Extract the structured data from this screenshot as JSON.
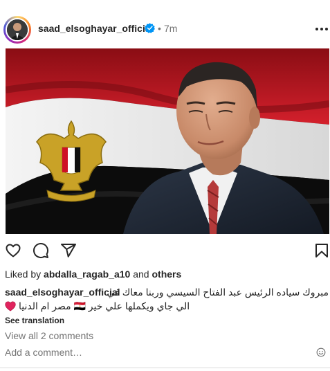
{
  "post": {
    "username": "saad_elsoghayar_official",
    "dot": "•",
    "timestamp": "7m",
    "liked_prefix": "Liked by",
    "liked_user": "abdalla_ragab_a10",
    "liked_and": "and",
    "liked_others": "others",
    "caption_user": "saad_elsoghayar_official",
    "caption_line1": "مبروك سياده الرئيس عبد الفتاح السيسي وربنا معاك في",
    "caption_line2": "الي جاي ويكملها علي خير 🇪🇬 مصر ام الدنيا",
    "see_translation": "See translation",
    "view_comments": "View all 2 comments",
    "add_comment_placeholder": "Add a comment…"
  },
  "icons": {
    "verified": "verified-badge-icon",
    "more": "more-options-icon",
    "like": "heart-icon",
    "comment": "comment-icon",
    "share": "paper-plane-icon",
    "save": "bookmark-icon",
    "emoji": "smiley-icon",
    "caption_emoji": "red-heart-emoji"
  },
  "colors": {
    "verified": "#0095f6",
    "muted": "#737373",
    "text": "#262626",
    "flag_red": "#ce1126",
    "flag_white": "#ffffff",
    "flag_black": "#000000",
    "eagle_gold": "#c09300"
  }
}
